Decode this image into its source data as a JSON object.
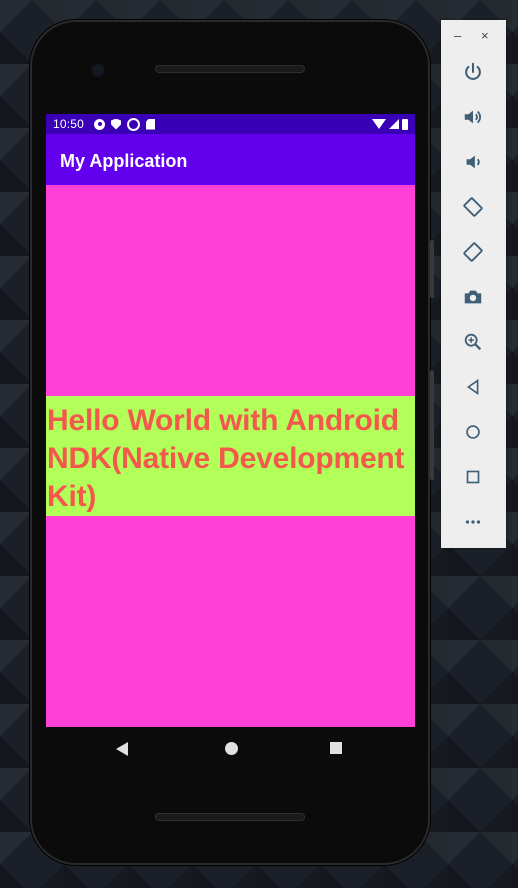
{
  "status_bar": {
    "time": "10:50"
  },
  "app_bar": {
    "title": "My Application"
  },
  "content": {
    "text": "Hello World with Android NDK(Native Development Kit)"
  },
  "emulator_toolbar": {
    "minimize": "–",
    "close": "×",
    "icons": [
      "power-icon",
      "volume-up-icon",
      "volume-down-icon",
      "rotate-left-icon",
      "rotate-right-icon",
      "camera-icon",
      "zoom-icon",
      "back-icon",
      "home-icon",
      "overview-icon",
      "more-icon"
    ]
  },
  "colors": {
    "status_bar": "#3a00b5",
    "app_bar": "#6200ee",
    "background": "#ff3fd6",
    "text_band": "#b2ff59",
    "text": "#f4574c"
  }
}
